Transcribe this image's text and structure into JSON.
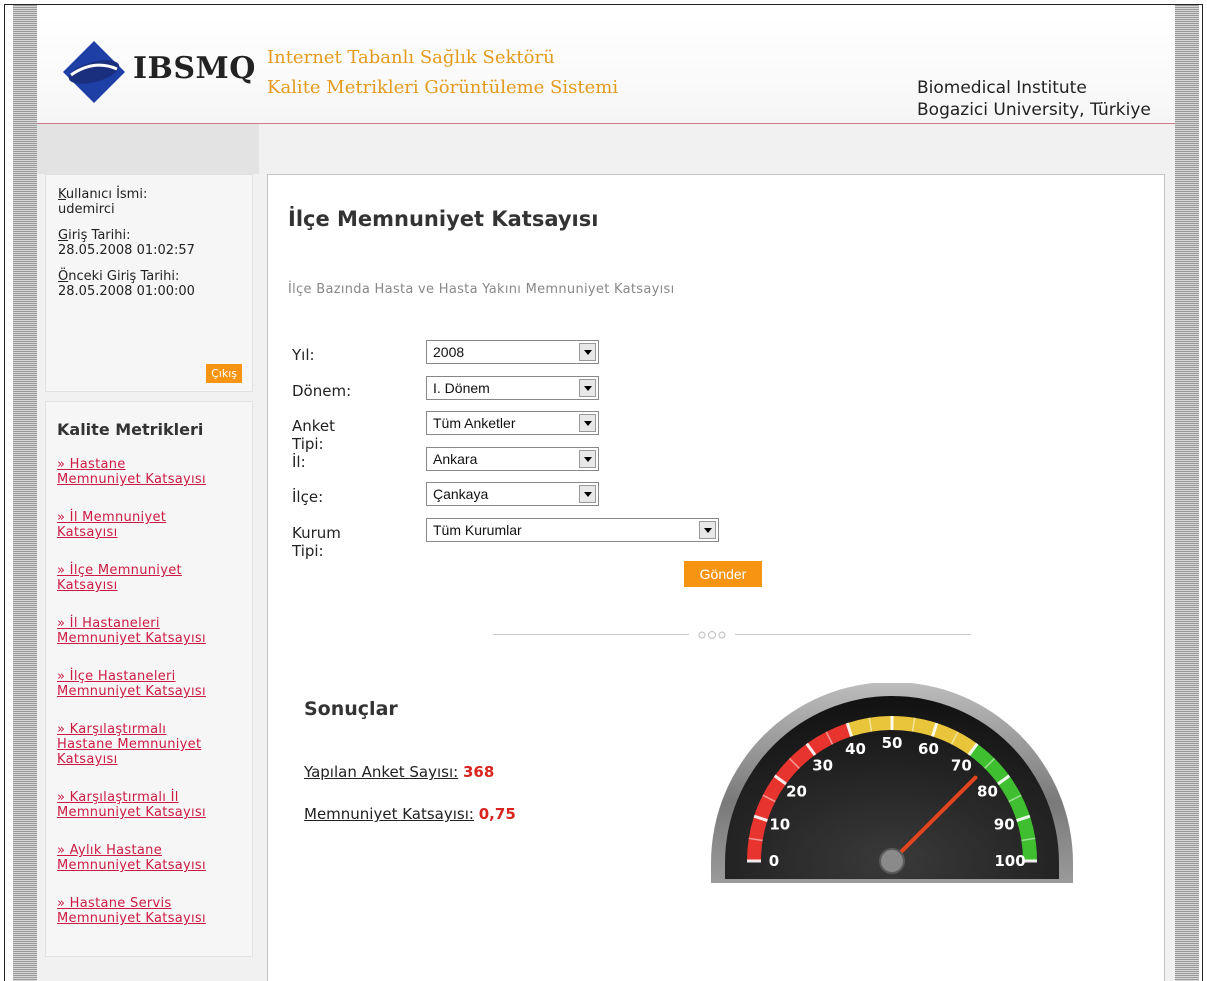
{
  "header": {
    "logo_text": "IBSMQ",
    "title_line1": "Internet Tabanlı Sağlık Sektörü",
    "title_line2": "Kalite Metrikleri Görüntüleme Sistemi",
    "institute_line1": "Biomedical Institute",
    "institute_line2": "Bogazici University, Türkiye"
  },
  "user": {
    "username_label": "Kullanıcı İsmi:",
    "username": "udemirci",
    "login_label": "Giriş Tarihi:",
    "login_date": "28.05.2008 01:02:57",
    "prev_login_label": "Önceki Giriş Tarihi:",
    "prev_login_date": "28.05.2008 01:00:00",
    "logout_label": "Çıkış"
  },
  "menu": {
    "title": "Kalite Metrikleri",
    "items": [
      {
        "line1": "» Hastane",
        "line2": "Memnuniyet Katsayısı",
        "line3": ""
      },
      {
        "line1": "» İl Memnuniyet",
        "line2": "Katsayısı",
        "line3": ""
      },
      {
        "line1": "» İlçe Memnuniyet",
        "line2": "Katsayısı",
        "line3": ""
      },
      {
        "line1": "» İl Hastaneleri",
        "line2": "Memnuniyet Katsayısı",
        "line3": ""
      },
      {
        "line1": "» İlçe Hastaneleri",
        "line2": "Memnuniyet Katsayısı",
        "line3": ""
      },
      {
        "line1": "» Karşılaştırmalı",
        "line2": "Hastane Memnuniyet",
        "line3": "Katsayısı"
      },
      {
        "line1": "» Karşılaştırmalı İl",
        "line2": "Memnuniyet Katsayısı",
        "line3": ""
      },
      {
        "line1": "» Aylık Hastane",
        "line2": "Memnuniyet Katsayısı",
        "line3": ""
      },
      {
        "line1": "» Hastane Servis",
        "line2": "Memnuniyet Katsayısı",
        "line3": ""
      }
    ]
  },
  "main": {
    "title": "İlçe Memnuniyet Katsayısı",
    "subtitle": "İlçe Bazında Hasta ve Hasta Yakını Memnuniyet Katsayısı",
    "form": {
      "year_label": "Yıl:",
      "year_value": "2008",
      "period_label": "Dönem:",
      "period_value": "I. Dönem",
      "survey_label": "Anket Tipi:",
      "survey_value": "Tüm Anketler",
      "city_label": "İl:",
      "city_value": "Ankara",
      "district_label": "İlçe:",
      "district_value": "Çankaya",
      "inst_label": "Kurum Tipi:",
      "inst_value": "Tüm Kurumlar",
      "submit_label": "Gönder"
    },
    "results": {
      "title": "Sonuçlar",
      "count_label": "Yapılan Anket Sayısı:",
      "count_value": "368",
      "coef_label": "Memnuniyet Katsayısı:",
      "coef_value": "0,75"
    }
  },
  "gauge": {
    "min": 0,
    "max": 100,
    "value": 75,
    "ticks": [
      "0",
      "10",
      "20",
      "30",
      "40",
      "50",
      "60",
      "70",
      "80",
      "90",
      "100"
    ],
    "colors": {
      "red": "#e8342e",
      "yellow": "#e8c53a",
      "green": "#3fbf2f",
      "needle": "#e2451c"
    }
  },
  "colors": {
    "accent": "#f79411",
    "link": "#cc1b43",
    "title_orange": "#e39a1d"
  }
}
